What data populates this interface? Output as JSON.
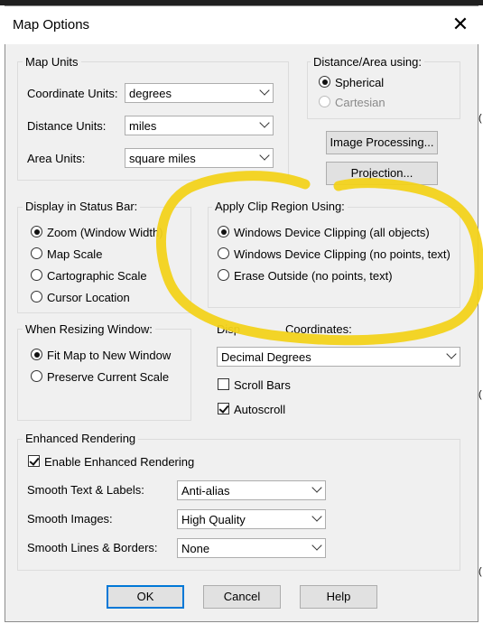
{
  "window": {
    "title": "Map Options",
    "close_glyph": "✕"
  },
  "map_units": {
    "title": "Map Units",
    "coordinate_label": "Coordinate Units:",
    "coordinate_value": "degrees",
    "distance_label": "Distance Units:",
    "distance_value": "miles",
    "area_label": "Area Units:",
    "area_value": "square miles"
  },
  "distance_area": {
    "title": "Distance/Area using:",
    "options": [
      {
        "label": "Spherical",
        "selected": true,
        "enabled": true
      },
      {
        "label": "Cartesian",
        "selected": false,
        "enabled": false
      }
    ]
  },
  "buttons": {
    "image_processing": "Image Processing...",
    "projection": "Projection...",
    "ok": "OK",
    "cancel": "Cancel",
    "help": "Help"
  },
  "status_bar": {
    "title": "Display in Status Bar:",
    "options": [
      {
        "label": "Zoom (Window Width)",
        "selected": true
      },
      {
        "label": "Map Scale",
        "selected": false
      },
      {
        "label": "Cartographic Scale",
        "selected": false
      },
      {
        "label": "Cursor Location",
        "selected": false
      }
    ]
  },
  "clip_region": {
    "title": "Apply Clip Region Using:",
    "options": [
      {
        "label": "Windows Device Clipping (all objects)",
        "selected": true
      },
      {
        "label": "Windows Device Clipping (no points, text)",
        "selected": false
      },
      {
        "label": "Erase Outside (no points, text)",
        "selected": false
      }
    ]
  },
  "resizing": {
    "title": "When Resizing Window:",
    "options": [
      {
        "label": "Fit Map to New Window",
        "selected": true
      },
      {
        "label": "Preserve Current Scale",
        "selected": false
      }
    ]
  },
  "display_coords": {
    "title_left": "Disp",
    "title_right": "Coordinates:",
    "value": "Decimal Degrees",
    "scroll_bars": {
      "label": "Scroll Bars",
      "checked": false
    },
    "autoscroll": {
      "label": "Autoscroll",
      "checked": true
    }
  },
  "enhanced": {
    "title": "Enhanced Rendering",
    "enable": {
      "label": "Enable Enhanced Rendering",
      "checked": true
    },
    "smooth_text_label": "Smooth Text & Labels:",
    "smooth_text_value": "Anti-alias",
    "smooth_images_label": "Smooth Images:",
    "smooth_images_value": "High Quality",
    "smooth_lines_label": "Smooth Lines & Borders:",
    "smooth_lines_value": "None"
  },
  "annotation": {
    "color": "#f2d21b"
  },
  "colors": {
    "default_button_border": "#0078d7"
  }
}
